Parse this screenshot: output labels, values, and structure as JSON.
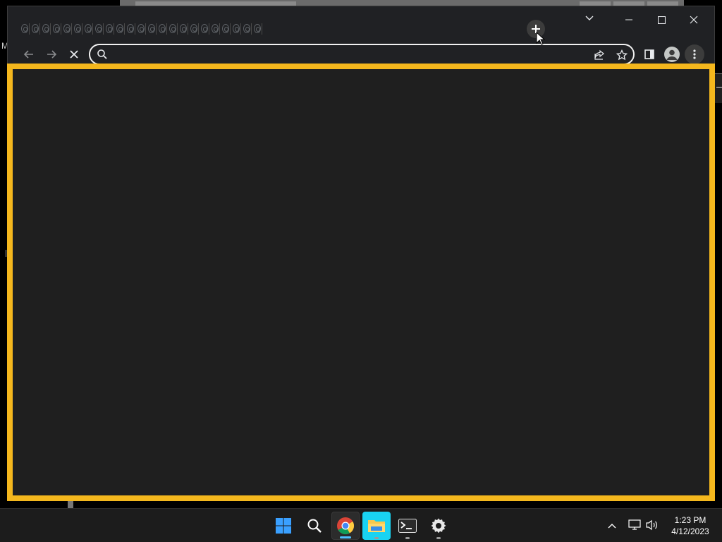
{
  "browser": {
    "tab_count": 23,
    "new_tab_label": "New tab",
    "omnibox": {
      "value": "",
      "placeholder": ""
    }
  },
  "desktop": {
    "bg_letter": "M"
  },
  "taskbar": {
    "apps": [
      {
        "name": "start",
        "icon": "windows-logo-icon"
      },
      {
        "name": "search",
        "icon": "search-icon"
      },
      {
        "name": "chrome",
        "icon": "chrome-icon",
        "running": true,
        "active": true
      },
      {
        "name": "file-explorer",
        "icon": "folder-icon",
        "running": true
      },
      {
        "name": "terminal",
        "icon": "terminal-icon",
        "running": true
      },
      {
        "name": "settings",
        "icon": "gear-icon",
        "running": true
      }
    ],
    "clock": {
      "time": "1:23 PM",
      "date": "4/12/2023"
    }
  },
  "colors": {
    "highlight": "#f4b71d",
    "browser_bg": "#202124",
    "taskbar_bg": "#1c1c1c",
    "explorer_accent": "#19d3f2",
    "running_indicator": "#4cc2ff"
  }
}
